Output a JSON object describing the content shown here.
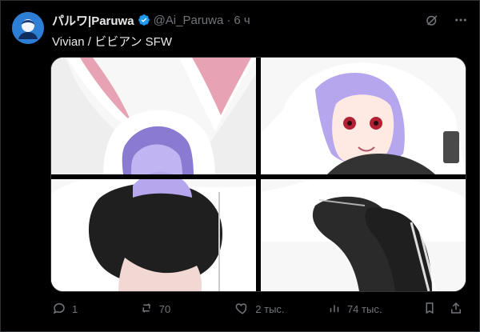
{
  "tweet": {
    "author": "パルワ|Paruwa",
    "handle": "@Ai_Paruwa",
    "separator": "·",
    "time": "6 ч",
    "text": "Vivian / ビビアン SFW"
  },
  "actions": {
    "reply_count": "1",
    "retweet_count": "70",
    "like_count": "2 тыс.",
    "view_count": "74 тыс."
  },
  "icons": {
    "verified": "verified-badge-icon",
    "grok": "grok-icon",
    "more": "more-icon",
    "reply": "reply-icon",
    "retweet": "retweet-icon",
    "like": "like-icon",
    "views": "views-icon",
    "bookmark": "bookmark-icon",
    "share": "share-icon"
  },
  "colors": {
    "background": "#000000",
    "text": "#e7e9ea",
    "secondary": "#71767b",
    "verified": "#1d9bf0",
    "border": "#2f3336"
  }
}
